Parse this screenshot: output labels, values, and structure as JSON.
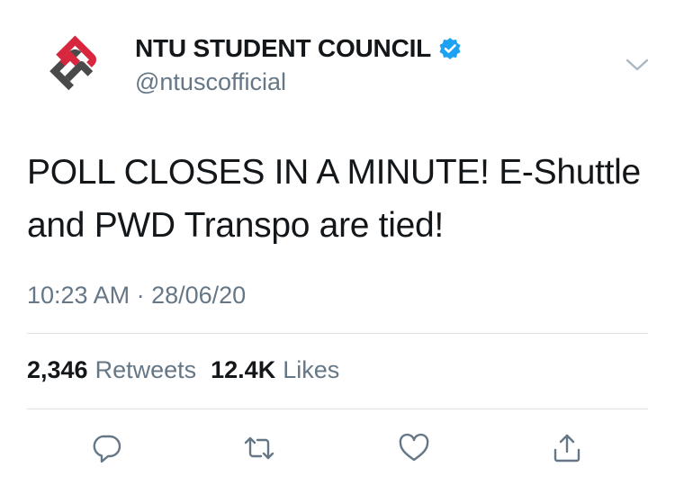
{
  "account": {
    "display_name": "NTU STUDENT COUNCIL",
    "handle": "@ntuscofficial",
    "verified": true
  },
  "tweet": {
    "text": "POLL CLOSES IN A MINUTE! E-Shuttle and PWD Transpo are tied!",
    "timestamp": "10:23 AM · 28/06/20"
  },
  "stats": {
    "retweets_count": "2,346",
    "retweets_label": "Retweets",
    "likes_count": "12.4K",
    "likes_label": "Likes"
  },
  "icons": {
    "verified": "verified-badge-icon",
    "menu": "chevron-down-icon",
    "reply": "reply-icon",
    "retweet": "retweet-icon",
    "like": "heart-icon",
    "share": "share-icon"
  },
  "colors": {
    "accent": "#1da1f2",
    "text": "#14171a",
    "secondary": "#657786",
    "divider": "#dfe3e8",
    "logo_red": "#d7263d",
    "logo_gray": "#4a4a4a"
  }
}
